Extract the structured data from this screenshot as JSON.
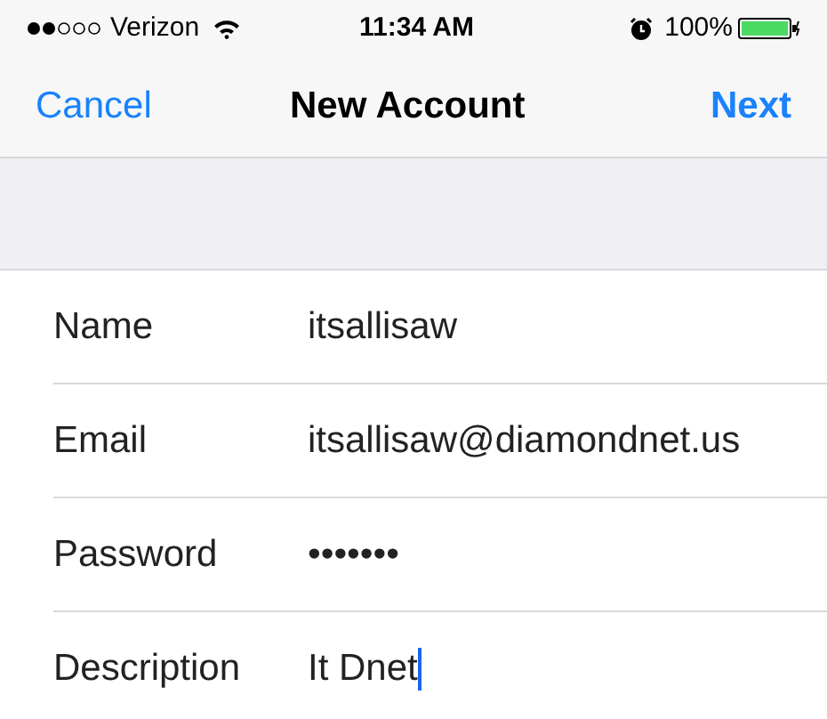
{
  "status_bar": {
    "carrier": "Verizon",
    "time": "11:34 AM",
    "battery": "100%"
  },
  "nav_bar": {
    "left": "Cancel",
    "title": "New Account",
    "right": "Next"
  },
  "fields": [
    {
      "label": "Name",
      "value": "itsallisaw",
      "focused": false
    },
    {
      "label": "Email",
      "value": "itsallisaw@diamondnet.us",
      "focused": false
    },
    {
      "label": "Password",
      "value": "•••••••",
      "focused": false
    },
    {
      "label": "Description",
      "value": "It Dnet",
      "focused": true
    }
  ]
}
